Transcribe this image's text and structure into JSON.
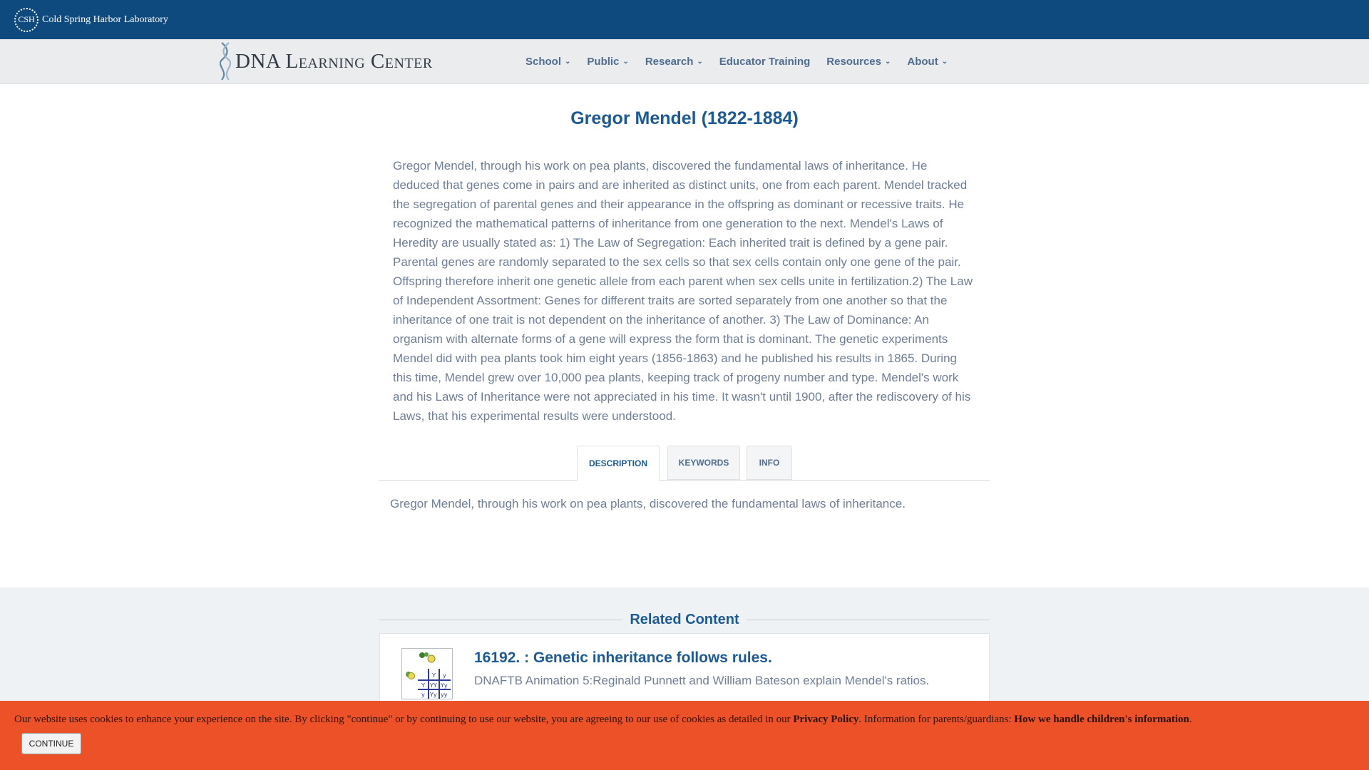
{
  "top_bar": {
    "seal_text": "CSH",
    "org_name": "Cold Spring Harbor Laboratory"
  },
  "nav": {
    "logo_text": "DNA Learning Center",
    "items": [
      {
        "label": "School",
        "has_dropdown": true
      },
      {
        "label": "Public",
        "has_dropdown": true
      },
      {
        "label": "Research",
        "has_dropdown": true
      },
      {
        "label": "Educator Training",
        "has_dropdown": false
      },
      {
        "label": "Resources",
        "has_dropdown": true
      },
      {
        "label": "About",
        "has_dropdown": true
      }
    ]
  },
  "page": {
    "title": "Gregor Mendel (1822-1884)",
    "intro": "Gregor Mendel, through his work on pea plants, discovered the fundamental laws of inheritance. He deduced that genes come in pairs and are inherited as distinct units, one from each parent. Mendel tracked the segregation of parental genes and their appearance in the offspring as dominant or recessive traits. He recognized the mathematical patterns of inheritance from one generation to the next. Mendel's Laws of Heredity are usually stated as: 1) The Law of Segregation: Each inherited trait is defined by a gene pair. Parental genes are randomly separated to the sex cells so that sex cells contain only one gene of the pair. Offspring therefore inherit one genetic allele from each parent when sex cells unite in fertilization.2) The Law of Independent Assortment: Genes for different traits are sorted separately from one another so that the inheritance of one trait is not dependent on the inheritance of another. 3) The Law of Dominance: An organism with alternate forms of a gene will express the form that is dominant. The genetic experiments Mendel did with pea plants took him eight years (1856-1863) and he published his results in 1865. During this time, Mendel grew over 10,000 pea plants, keeping track of progeny number and type. Mendel's work and his Laws of Inheritance were not appreciated in his time. It wasn't until 1900, after the rediscovery of his Laws, that his experimental results were understood."
  },
  "tabs": {
    "items": [
      {
        "label": "DESCRIPTION",
        "active": true
      },
      {
        "label": "KEYWORDS",
        "active": false
      },
      {
        "label": "INFO",
        "active": false
      }
    ],
    "description_text": "Gregor Mendel, through his work on pea plants, discovered the fundamental laws of inheritance."
  },
  "related": {
    "heading": "Related Content",
    "items": [
      {
        "title": "16192. : Genetic inheritance follows rules.",
        "description": "DNAFTB Animation 5:Reginald Punnett and William Bateson explain Mendel's ratios.",
        "thumb_letters": [
          "Y",
          "y",
          "Y",
          "YY",
          "Yy",
          "y",
          "Yy",
          "yy"
        ]
      }
    ]
  },
  "cookie": {
    "text_before": "Our website uses cookies to enhance your experience on the site. By clicking \"continue\" or by continuing to use our website, you are agreeing to our use of cookies as detailed in our ",
    "privacy_link": "Privacy Policy",
    "text_middle": ". Information for parents/guardians: ",
    "children_link": "How we handle children's information",
    "text_after": ".",
    "button_label": "CONTINUE"
  },
  "colors": {
    "top_bar": "#0e4a7e",
    "nav_bg": "#ebecee",
    "title_blue": "#1c5a97",
    "body_text": "#6d7f96",
    "related_bg": "#eef2f5",
    "cookie_bg": "#ed5128"
  }
}
